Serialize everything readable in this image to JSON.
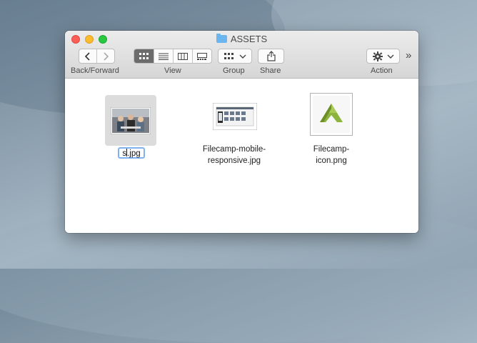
{
  "window": {
    "title": "ASSETS"
  },
  "toolbar": {
    "back_forward_label": "Back/Forward",
    "view_label": "View",
    "group_label": "Group",
    "share_label": "Share",
    "action_label": "Action",
    "overflow_glyph": "»",
    "back_glyph": "‹",
    "forward_glyph": "›"
  },
  "files": [
    {
      "name_line1": "s",
      "name_line2": ".jpg",
      "editing": true,
      "thumbnail": "photo-people"
    },
    {
      "name_line1": "Filecamp-mobile-",
      "name_line2": "responsive.jpg",
      "thumbnail": "mobile-screens"
    },
    {
      "name_line1": "Filecamp-",
      "name_line2": "icon.png",
      "thumbnail": "filecamp-logo"
    }
  ],
  "colors": {
    "accent": "#7fb2ef",
    "folder": "#6bb6ef",
    "logo_green": "#8cb43c"
  }
}
